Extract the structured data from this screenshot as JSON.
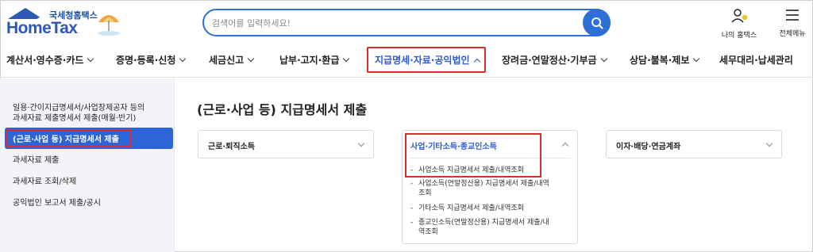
{
  "header": {
    "logo_sub": "국세청홈택스",
    "logo_main": "HomeTax",
    "search_placeholder": "검색어를 입력하세요!",
    "myhome_label": "나의 홈택스",
    "allmenu_label": "전체메뉴"
  },
  "nav": {
    "items": [
      {
        "label": "계산서·영수증·카드"
      },
      {
        "label": "증명·등록·신청"
      },
      {
        "label": "세금신고"
      },
      {
        "label": "납부·고지·환급"
      },
      {
        "label": "지급명세·자료·공익법인"
      },
      {
        "label": "장려금·연말정산·기부금"
      },
      {
        "label": "상담·불복·제보"
      },
      {
        "label": "세무대리·납세관리"
      }
    ],
    "active_index": 4
  },
  "sidebar": {
    "items": [
      {
        "label": "일용·간이지급명세서/사업장제공자 등의"
      },
      {
        "label": "과세자료 제출명세서 제출(매월·반기)"
      },
      {
        "label": "(근로·사업 등) 지급명세서 제출"
      },
      {
        "label": "과세자료 제출"
      },
      {
        "label": "과세자료 조회/삭제"
      },
      {
        "label": "공익법인 보고서 제출/공시"
      }
    ]
  },
  "main": {
    "title": "(근로·사업 등) 지급명세서 제출",
    "cards": [
      {
        "label": "근로·퇴직소득"
      },
      {
        "label": "사업·기타소득·종교인소득"
      },
      {
        "label": "이자·배당·연금계좌"
      }
    ],
    "submenu": [
      {
        "line1": "사업소득 지급명세서 제출/내역조회",
        "line2": ""
      },
      {
        "line1": "사업소득(연말정산용) 지급명세서 제출/내역",
        "line2": "조회"
      },
      {
        "line1": "기타소득 지급명세서 제출/내역조회",
        "line2": ""
      },
      {
        "line1": "종교인소득(연말정산용) 지급명세서 제출/내",
        "line2": "역조회"
      }
    ]
  },
  "colors": {
    "brand_blue": "#2d59b5",
    "accent_blue": "#2d64d6",
    "highlight_red": "#d83030"
  }
}
